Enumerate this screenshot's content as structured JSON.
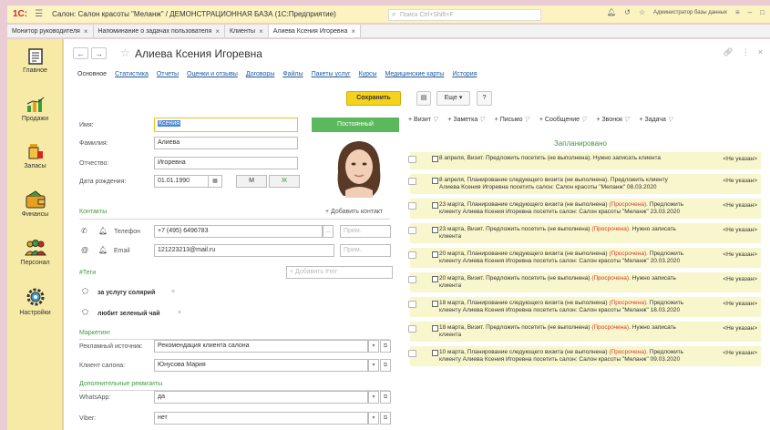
{
  "titlebar": {
    "logo": "1С:",
    "menu_icon": "hamburger-icon",
    "title": "Салон: Салон красоты \"Меланж\" / ДЕМОНСТРАЦИОННАЯ БАЗА  (1С:Предприятие)",
    "search_placeholder": "Поиск Ctrl+Shift+F",
    "user": "Администратор базы данных"
  },
  "open_tabs": [
    {
      "label": "Монитор руководителя"
    },
    {
      "label": "Напоминание о задачах пользователя"
    },
    {
      "label": "Клиенты"
    },
    {
      "label": "Алиева Ксения Игоревна"
    }
  ],
  "sidebar": {
    "items": [
      {
        "label": "Главное",
        "icon": "document-icon"
      },
      {
        "label": "Продажи",
        "icon": "chart-icon"
      },
      {
        "label": "Запасы",
        "icon": "jars-icon"
      },
      {
        "label": "Финансы",
        "icon": "wallet-icon"
      },
      {
        "label": "Персонал",
        "icon": "people-icon"
      },
      {
        "label": "Настройки",
        "icon": "gear-icon"
      }
    ]
  },
  "form": {
    "title": "Алиева Ксения Игоревна",
    "tabs": [
      {
        "label": "Основное"
      },
      {
        "label": "Статистика"
      },
      {
        "label": "Отчеты"
      },
      {
        "label": "Оценки и отзывы"
      },
      {
        "label": "Договоры"
      },
      {
        "label": "Файлы"
      },
      {
        "label": "Пакеты услуг"
      },
      {
        "label": "Курсы"
      },
      {
        "label": "Медицинские карты"
      },
      {
        "label": "История"
      }
    ],
    "save_label": "Сохранить",
    "more_label": "Еще ▾",
    "help_label": "?",
    "name_label": "Имя:",
    "name_value": "Ксения",
    "surname_label": "Фамилия:",
    "surname_value": "Алиева",
    "patronymic_label": "Отчество:",
    "patronymic_value": "Игоревна",
    "birthdate_label": "Дата рождения:",
    "birthdate_value": "01.01.1990",
    "gender_m": "М",
    "gender_f": "Ж",
    "status_label": "Постоянный",
    "contacts_header": "Контакты",
    "add_contact": "+ Добавить контакт",
    "phone_label": "Телефон",
    "phone_value": "+7 (495) 6496783",
    "phone_note": "Прим.",
    "email_label": "Email",
    "email_value": "121223213@mail.ru",
    "email_note": "Прим.",
    "tags_header": "#Теги",
    "add_tag": "+ Добавить #тег",
    "tags": [
      {
        "label": "за услугу солярий"
      },
      {
        "label": "любит зеленый чай"
      }
    ],
    "marketing_header": "Маркетинг",
    "ad_source_label": "Рекламный источник:",
    "ad_source_value": "Рекомендация клиента салона",
    "salon_client_label": "Клиент салона:",
    "salon_client_value": "Юнусова Мария",
    "extra_header": "Дополнительные реквизиты",
    "whatsapp_label": "WhatsApp:",
    "whatsapp_value": "да",
    "viber_label": "Viber:",
    "viber_value": "нет"
  },
  "activity": {
    "filters": [
      {
        "label": "+ Визит"
      },
      {
        "label": "+ Заметка"
      },
      {
        "label": "+ Письмо"
      },
      {
        "label": "+ Сообщение"
      },
      {
        "label": "+ Звонок"
      },
      {
        "label": "+ Задача"
      }
    ],
    "scheduled_label": "Запланировано",
    "events": [
      {
        "line1": "8 апреля, Визит. Предложить посетить (не выполнена). Нужно записать",
        "overdue": "",
        "rest": "клиента",
        "assignee": "<Не указан>"
      },
      {
        "line1": "8 апреля, Планирование следующего визита (не выполнена). Предложить",
        "overdue": "",
        "rest": "клиенту Алиева Ксения Игоревна посетить салон: Салон красоты \"Меланж\" 08.03.2020",
        "assignee": "<Не указан>"
      },
      {
        "line1": "23 марта, Планирование следующего визита (не выполнена)",
        "overdue": "(Просрочена).",
        "rest": "Предложить клиенту Алиева Ксения Игоревна посетить салон: Салон красоты \"Меланж\" 23.03.2020",
        "assignee": "<Не указан>"
      },
      {
        "line1": "23 марта, Визит. Предложить посетить (не выполнена)",
        "overdue": "(Просрочена).",
        "rest": "Нужно записать клиента",
        "assignee": "<Не указан>"
      },
      {
        "line1": "20 марта, Планирование следующего визита (не выполнена)",
        "overdue": "(Просрочена).",
        "rest": "Предложить клиенту Алиева Ксения Игоревна посетить салон: Салон красоты \"Меланж\" 20.03.2020",
        "assignee": "<Не указан>"
      },
      {
        "line1": "20 марта, Визит. Предложить посетить (не выполнена)",
        "overdue": "(Просрочена).",
        "rest": "Нужно записать клиента",
        "assignee": "<Не указан>"
      },
      {
        "line1": "18 марта, Планирование следующего визита (не выполнена)",
        "overdue": "(Просрочена).",
        "rest": "Предложить клиенту Алиева Ксения Игоревна посетить салон: Салон красоты \"Меланж\" 18.03.2020",
        "assignee": "<Не указан>"
      },
      {
        "line1": "18 марта, Визит. Предложить посетить (не выполнена)",
        "overdue": "(Просрочена).",
        "rest": "Нужно записать клиента",
        "assignee": "<Не указан>"
      },
      {
        "line1": "10 марта, Планирование следующего визита (не выполнена)",
        "overdue": "(Просрочена).",
        "rest": "Предложить клиенту Алиева Ксения Игоревна посетить салон: Салон красоты \"Меланж\" 09.03.2020",
        "assignee": "<Не указан>"
      }
    ]
  },
  "colors": {
    "accent": "#f5d21d",
    "sidebar": "#f7e9a6",
    "status_green": "#5cb85c",
    "overdue": "#d63a2a",
    "event_bg": "#f8f6cc",
    "link": "#1c5aa0"
  }
}
